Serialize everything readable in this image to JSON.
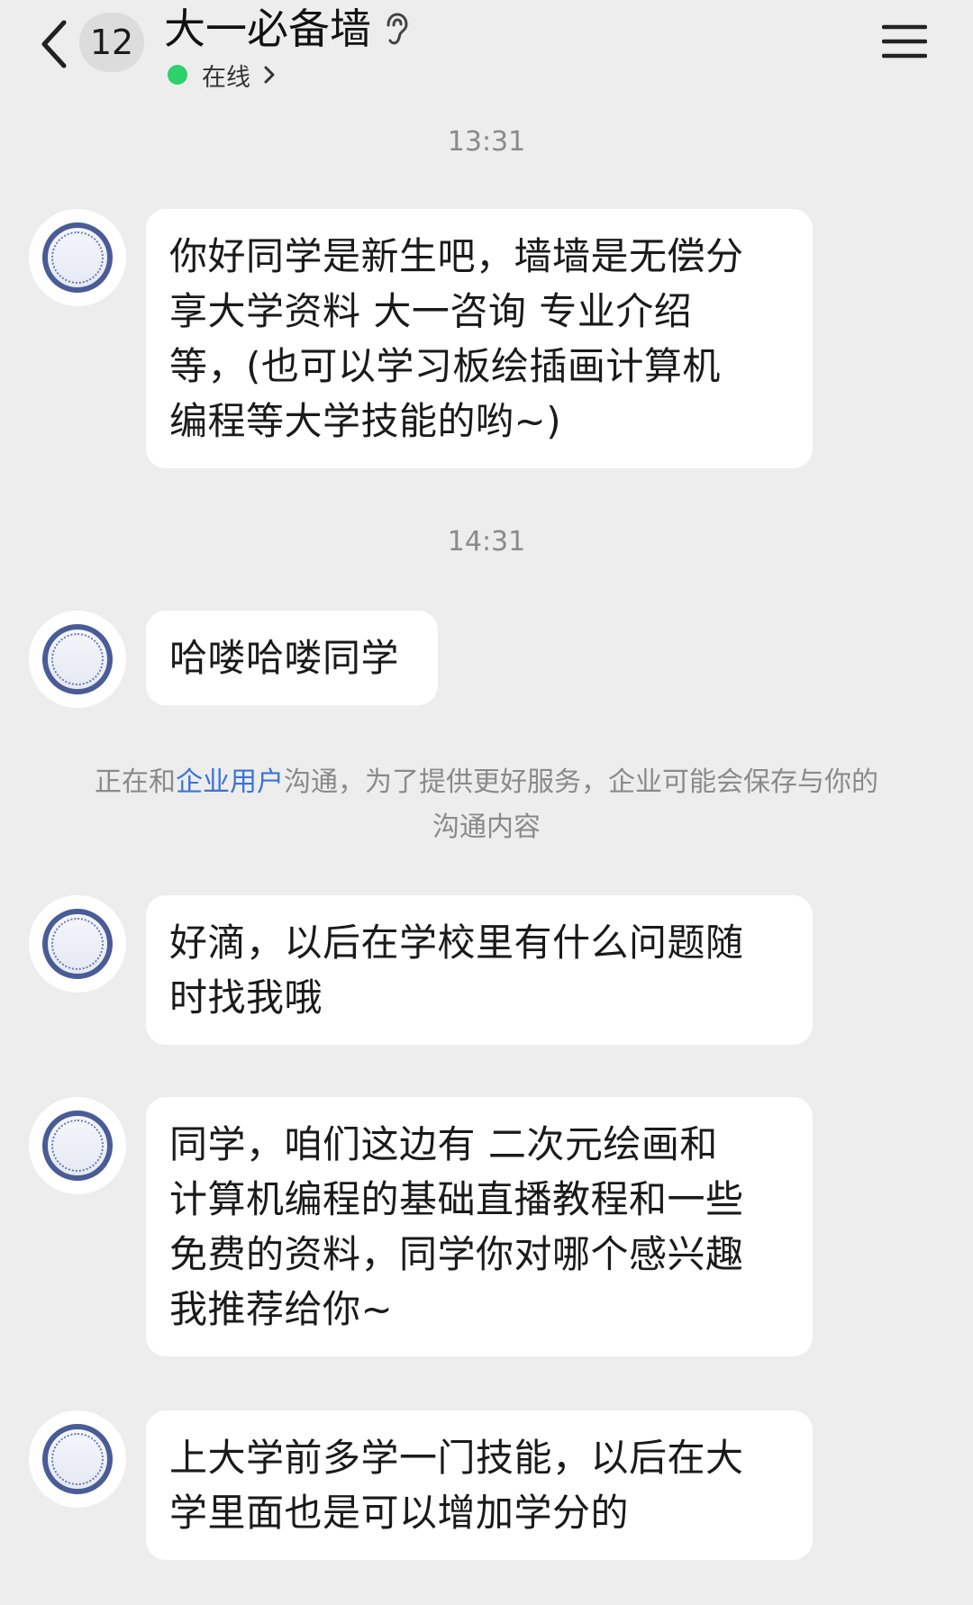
{
  "header": {
    "back_icon": "chevron-left-icon",
    "unread_count": "12",
    "title": "大一必备墙",
    "ear_icon": "ear-icon",
    "status_text": "在线",
    "status_arrow": "›",
    "status_color": "#2bd16a",
    "menu_icon": "hamburger-menu-icon"
  },
  "timestamps": [
    "13:31",
    "14:31"
  ],
  "notice": {
    "before": "正在和",
    "link": "企业用户",
    "after_line1": "沟通，为了提供更好服务，企业可能会保存与你的",
    "line2": "沟通内容"
  },
  "messages": [
    {
      "sender": "incoming",
      "lines": [
        "你好同学是新生吧，墙墙是无偿分",
        "享大学资料 大一咨询 专业介绍",
        "等，(也可以学习板绘插画计算机",
        "编程等大学技能的哟~)"
      ]
    },
    {
      "sender": "incoming",
      "lines": [
        "哈喽哈喽同学"
      ]
    },
    {
      "sender": "incoming",
      "lines": [
        "好滴，以后在学校里有什么问题随",
        "时找我哦"
      ]
    },
    {
      "sender": "incoming",
      "lines": [
        "同学，咱们这边有 二次元绘画和",
        "计算机编程的基础直播教程和一些",
        "免费的资料，同学你对哪个感兴趣",
        "我推荐给你~"
      ]
    },
    {
      "sender": "incoming",
      "lines": [
        "上大学前多学一门技能，以后在大",
        "学里面也是可以增加学分的"
      ]
    }
  ],
  "colors": {
    "background": "#ededed",
    "bubble": "#ffffff",
    "link": "#3a74d6",
    "muted_text": "#8a8a8a"
  }
}
